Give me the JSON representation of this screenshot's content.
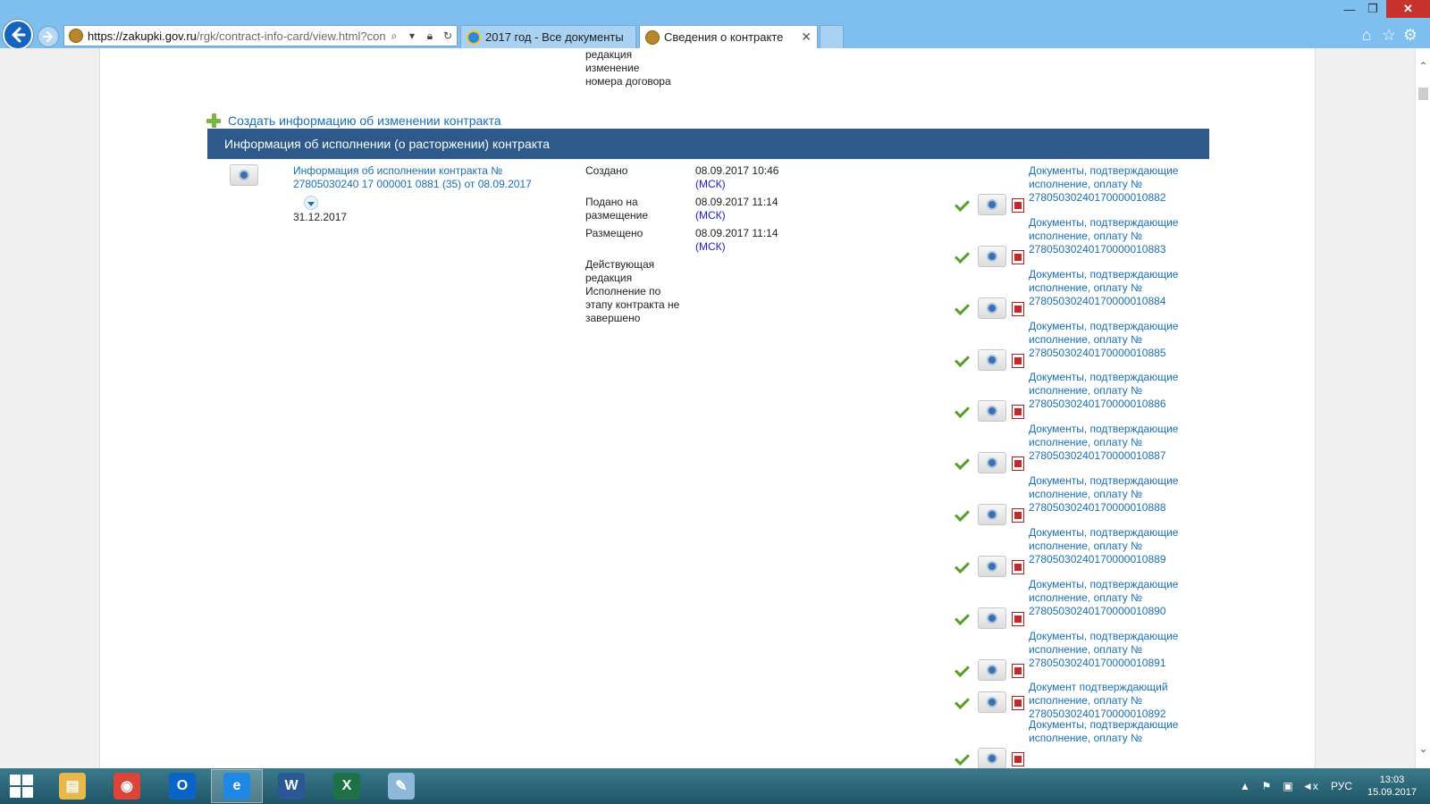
{
  "browser": {
    "address": {
      "host": "https://zakupki.gov.ru",
      "path": "/rgk/contract-info-card/view.html?contrac"
    },
    "tabs": [
      {
        "label": "2017 год - Все документы"
      },
      {
        "label": "Сведения о контракте",
        "close": "✕"
      }
    ],
    "window_controls": {
      "minimize": "—",
      "maximize": "❐",
      "close": "✕"
    }
  },
  "page": {
    "prev_text": [
      "редакция",
      "изменение",
      "номера договора"
    ],
    "create_link": "Создать информацию об изменении контракта",
    "section_header": "Информация об исполнении (о расторжении) контракта",
    "record": {
      "link": "Информация об исполнении контракта № 27805030240 17 000001 0881 (35) от 08.09.2017",
      "date": "31.12.2017",
      "meta": [
        {
          "label": "Создано",
          "value": "08.09.2017 10:46",
          "tz": "(МСК)"
        },
        {
          "label": "Подано на размещение",
          "value": "08.09.2017 11:14",
          "tz": "(МСК)"
        },
        {
          "label": "Размещено",
          "value": "08.09.2017 11:14",
          "tz": "(МСК)"
        },
        {
          "label": "Действующая редакция Исполнение по этапу контракта не завершено",
          "value": "",
          "tz": ""
        }
      ]
    },
    "documents": [
      {
        "text": "Документы, подтверждающие исполнение, оплату № 27805030240170000010882"
      },
      {
        "text": "Документы, подтверждающие исполнение, оплату № 27805030240170000010883"
      },
      {
        "text": "Документы, подтверждающие исполнение, оплату № 27805030240170000010884"
      },
      {
        "text": "Документы, подтверждающие исполнение, оплату № 27805030240170000010885"
      },
      {
        "text": "Документы, подтверждающие исполнение, оплату № 27805030240170000010886"
      },
      {
        "text": "Документы, подтверждающие исполнение, оплату № 27805030240170000010887"
      },
      {
        "text": "Документы, подтверждающие исполнение, оплату № 27805030240170000010888"
      },
      {
        "text": "Документы, подтверждающие исполнение, оплату № 27805030240170000010889"
      },
      {
        "text": "Документы, подтверждающие исполнение, оплату № 27805030240170000010890"
      },
      {
        "text": "Документы, подтверждающие исполнение, оплату № 27805030240170000010891"
      },
      {
        "text": "Документ подтверждающий исполнение, оплату № 27805030240170000010892"
      },
      {
        "text": "Документы, подтверждающие исполнение, оплату №"
      }
    ]
  },
  "taskbar": {
    "apps": [
      {
        "name": "file-explorer",
        "glyph": "▤",
        "color": "#e8b84a"
      },
      {
        "name": "chrome",
        "glyph": "◉",
        "color": "#db4437"
      },
      {
        "name": "outlook",
        "glyph": "O",
        "color": "#0a64c8"
      },
      {
        "name": "internet-explorer",
        "glyph": "e",
        "color": "#1e88e5"
      },
      {
        "name": "word",
        "glyph": "W",
        "color": "#2b5797"
      },
      {
        "name": "excel",
        "glyph": "X",
        "color": "#1e7145"
      },
      {
        "name": "paint",
        "glyph": "✎",
        "color": "#8fb8d8"
      }
    ],
    "tray": {
      "language": "РУС",
      "overflow": "▲",
      "flag": "⚑",
      "network": "▣",
      "volume": "◄x"
    },
    "clock": {
      "time": "13:03",
      "date": "15.09.2017"
    }
  }
}
